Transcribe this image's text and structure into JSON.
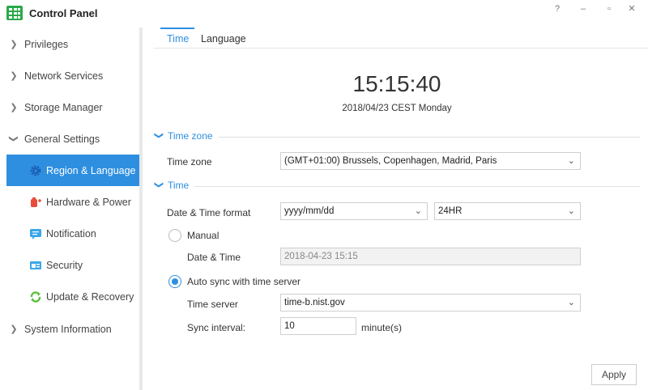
{
  "window": {
    "title": "Control Panel",
    "help_label": "?",
    "minimize_label": "–",
    "restore_label": "▫",
    "close_label": "✕"
  },
  "sidebar": {
    "items": [
      {
        "label": "Privileges",
        "icon": "chevron-right-icon"
      },
      {
        "label": "Network Services",
        "icon": "chevron-right-icon"
      },
      {
        "label": "Storage Manager",
        "icon": "chevron-right-icon"
      },
      {
        "label": "General Settings",
        "icon": "chevron-down-icon"
      },
      {
        "label": "Region & Language",
        "icon": "gear-icon",
        "active": true
      },
      {
        "label": "Hardware & Power",
        "icon": "power-icon"
      },
      {
        "label": "Notification",
        "icon": "chat-icon"
      },
      {
        "label": "Security",
        "icon": "shield-icon"
      },
      {
        "label": "Update & Recovery",
        "icon": "refresh-icon"
      },
      {
        "label": "System Information",
        "icon": "chevron-right-icon"
      }
    ]
  },
  "tabs": [
    {
      "label": "Time",
      "active": true
    },
    {
      "label": "Language",
      "active": false
    }
  ],
  "clock": {
    "time": "15:15:40",
    "date": "2018/04/23 CEST Monday"
  },
  "sections": {
    "timezone": {
      "title": "Time zone",
      "label": "Time zone",
      "value": "(GMT+01:00) Brussels, Copenhagen, Madrid, Paris"
    },
    "time": {
      "title": "Time",
      "format_label": "Date & Time format",
      "date_format": "yyyy/mm/dd",
      "hour_format": "24HR",
      "manual_label": "Manual",
      "datetime_label": "Date & Time",
      "datetime_value": "2018-04-23 15:15",
      "auto_label": "Auto sync with time server",
      "server_label": "Time server",
      "server_value": "time-b.nist.gov",
      "interval_label": "Sync interval:",
      "interval_value": "10",
      "interval_unit": "minute(s)"
    }
  },
  "apply_label": "Apply",
  "colors": {
    "accent": "#2e8fe0",
    "logo": "#2ba84a"
  }
}
